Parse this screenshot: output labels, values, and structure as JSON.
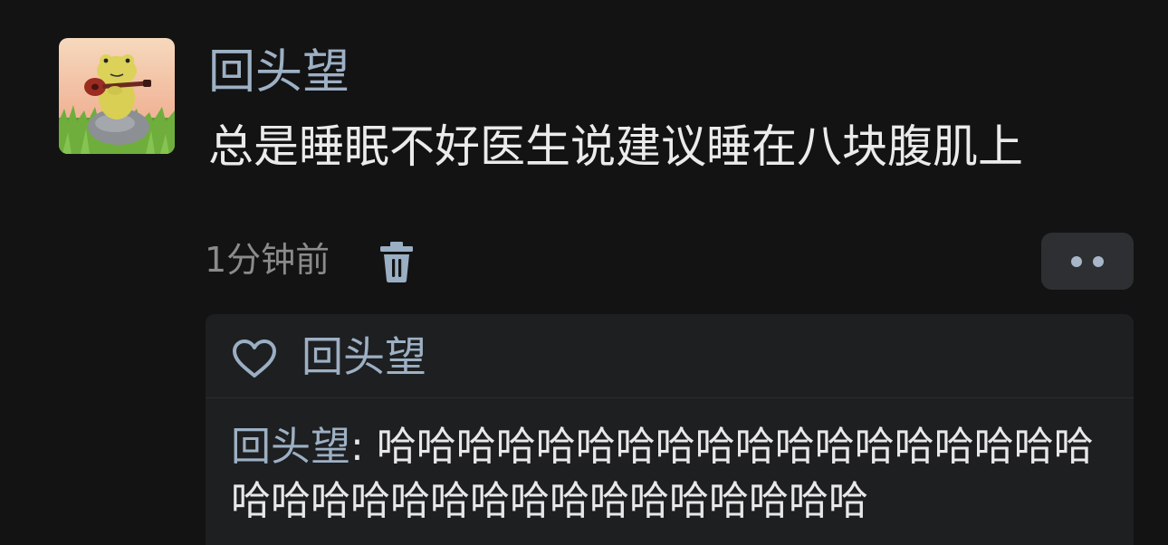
{
  "post": {
    "author": "回头望",
    "text": "总是睡眠不好医生说建议睡在八块腹肌上",
    "time": "1分钟前",
    "avatar_icon": "frog-with-ukulele-avatar",
    "delete_icon": "trash-icon",
    "more_icon": "more-dots-icon"
  },
  "likes": {
    "icon": "heart-outline-icon",
    "names": "回头望"
  },
  "comments": [
    {
      "author": "回头望",
      "separator": ": ",
      "text": "哈哈哈哈哈哈哈哈哈哈哈哈哈哈哈哈哈哈哈哈哈哈哈哈哈哈哈哈哈哈哈哈哈哈"
    }
  ],
  "colors": {
    "background": "#131313",
    "name": "#9db0c4",
    "text": "#ebebeb",
    "meta": "#8b8b8b",
    "panel": "#1e1f21",
    "button": "#2d2f32"
  }
}
